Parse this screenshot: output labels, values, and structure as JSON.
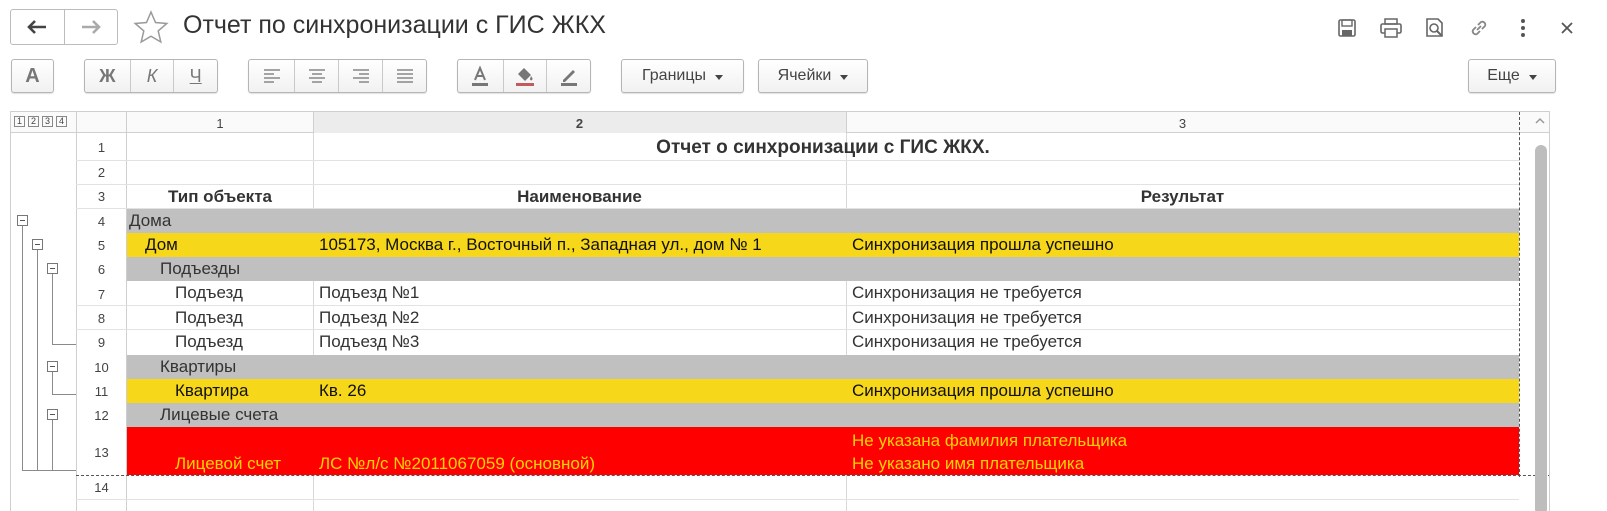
{
  "window": {
    "title": "Отчет по синхронизации с ГИС ЖКХ",
    "nav": {
      "back_icon": "arrow-left-icon",
      "forward_icon": "arrow-right-icon"
    },
    "favorite_icon": "star-icon",
    "actions": [
      "save-icon",
      "print-icon",
      "preview-icon",
      "link-icon",
      "more-icon",
      "close-icon"
    ]
  },
  "toolbar": {
    "font_label": "A",
    "bold_label": "Ж",
    "italic_label": "К",
    "underline_label": "Ч",
    "borders_label": "Границы",
    "cells_label": "Ячейки",
    "more_label": "Еще"
  },
  "sheet": {
    "group_levels": [
      "1",
      "2",
      "3",
      "4"
    ],
    "columns": [
      "1",
      "2",
      "3"
    ],
    "row_numbers": [
      "1",
      "2",
      "3",
      "4",
      "5",
      "6",
      "7",
      "8",
      "9",
      "10",
      "11",
      "12",
      "13",
      "14"
    ],
    "report_title": "Отчет о синхронизации с ГИС ЖКХ.",
    "headers": {
      "type": "Тип объекта",
      "name": "Наименование",
      "result": "Результат"
    },
    "rows": [
      {
        "type": "Дома",
        "name": "",
        "result": ""
      },
      {
        "type": "Дом",
        "name": "105173, Москва г., Восточный п., Западная ул., дом № 1",
        "result": "Синхронизация прошла успешно"
      },
      {
        "type": "Подъезды",
        "name": "",
        "result": ""
      },
      {
        "type": "Подъезд",
        "name": "Подъезд №1",
        "result": "Синхронизация не требуется"
      },
      {
        "type": "Подъезд",
        "name": "Подъезд №2",
        "result": "Синхронизация не требуется"
      },
      {
        "type": "Подъезд",
        "name": "Подъезд №3",
        "result": "Синхронизация не требуется"
      },
      {
        "type": "Квартиры",
        "name": "",
        "result": ""
      },
      {
        "type": "Квартира",
        "name": "Кв. 26",
        "result": "Синхронизация прошла успешно"
      },
      {
        "type": "Лицевые счета",
        "name": "",
        "result": ""
      },
      {
        "type": "Лицевой счет",
        "name": "ЛС №л/с №2011067059 (основной)",
        "result": "Не указана фамилия плательщика",
        "result2": "Не указано имя плательщика"
      }
    ],
    "colors": {
      "group_row": "#c0c0c0",
      "success_row": "#f7d71a",
      "error_row": "#ff0000",
      "error_text": "#ffd500"
    }
  }
}
